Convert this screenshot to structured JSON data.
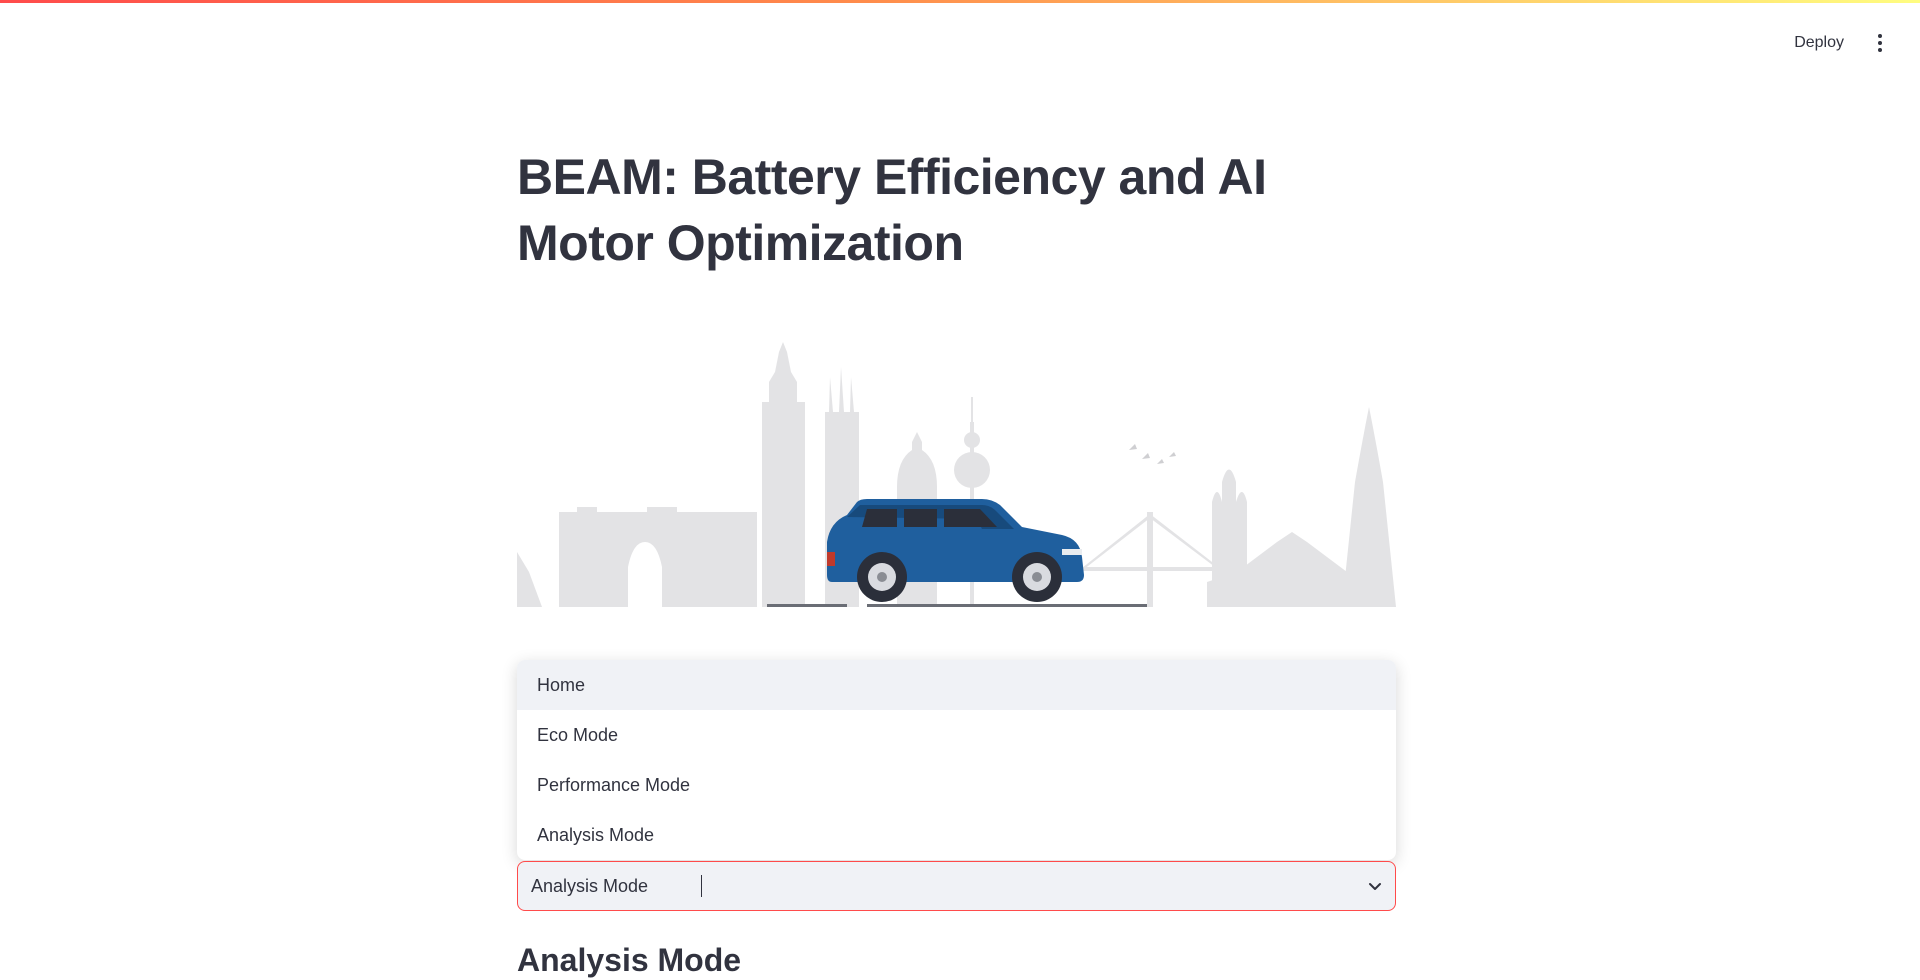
{
  "header": {
    "deploy_label": "Deploy",
    "menu_icon": "kebab-menu-icon"
  },
  "main": {
    "title": "BEAM: Battery Efficiency and AI Motor Optimization",
    "hero_image": "car-city-skyline-illustration",
    "mode_select": {
      "value": "Analysis Mode",
      "options": [
        "Home",
        "Eco Mode",
        "Performance Mode",
        "Analysis Mode"
      ],
      "highlighted_option": "Home"
    },
    "section_heading": "Analysis Mode"
  },
  "colors": {
    "accent": "#ff4b4b",
    "text": "#31333f",
    "input_bg": "#f0f2f6",
    "car_body": "#1f5f9e",
    "skyline": "#e3e3e5"
  }
}
